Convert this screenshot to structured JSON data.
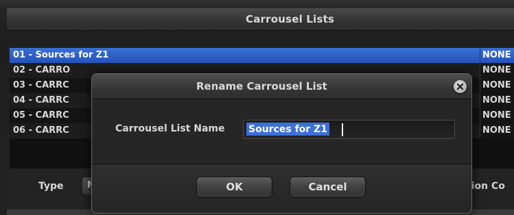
{
  "window": {
    "title": "Carrousel Lists"
  },
  "list": {
    "rows": [
      {
        "name": "01 - Sources for Z1",
        "status": "NONE",
        "selected": true
      },
      {
        "name": "02 - CARRO",
        "status": "NONE",
        "selected": false
      },
      {
        "name": "03 - CARRC",
        "status": "NONE",
        "selected": false
      },
      {
        "name": "04 - CARRC",
        "status": "NONE",
        "selected": false
      },
      {
        "name": "05 - CARRC",
        "status": "NONE",
        "selected": false
      },
      {
        "name": "06 - CARRC",
        "status": "NONE",
        "selected": false
      }
    ]
  },
  "bottom": {
    "type_label": "Type",
    "type_value": "N",
    "right_label": "tion Co"
  },
  "dialog": {
    "title": "Rename Carrousel List",
    "close_icon": "close-icon",
    "field_label": "Carrousel List Name",
    "field_value": "Sources for Z1",
    "ok_label": "OK",
    "cancel_label": "Cancel"
  },
  "colors": {
    "selection": "#2f5fc8",
    "dialog_background": "#2a2a2a",
    "text": "#d8d8d8"
  }
}
